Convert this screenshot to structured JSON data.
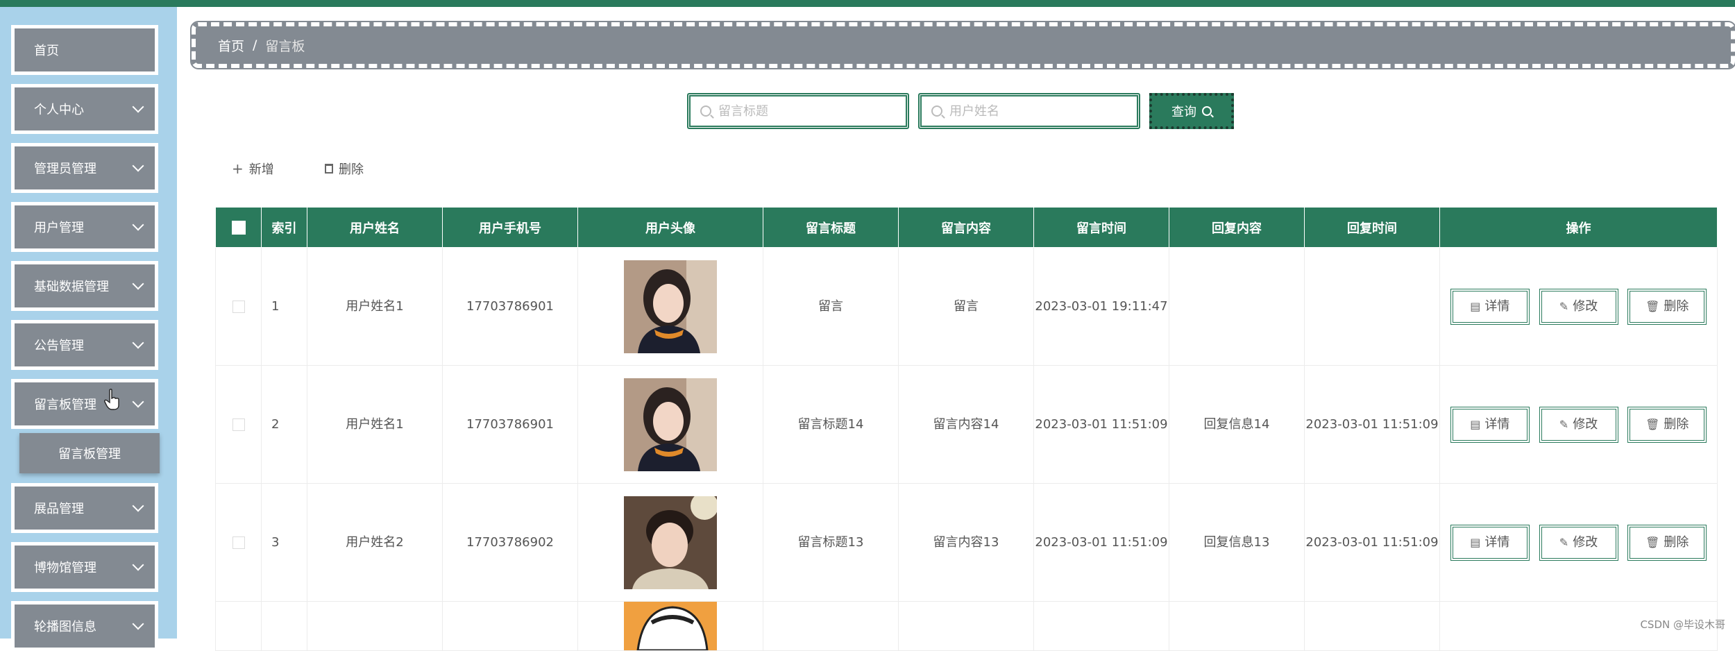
{
  "sidebar": {
    "items": [
      {
        "label": "首页",
        "has_children": false
      },
      {
        "label": "个人中心",
        "has_children": true
      },
      {
        "label": "管理员管理",
        "has_children": true
      },
      {
        "label": "用户管理",
        "has_children": true
      },
      {
        "label": "基础数据管理",
        "has_children": true
      },
      {
        "label": "公告管理",
        "has_children": true
      },
      {
        "label": "留言板管理",
        "has_children": true
      },
      {
        "label": "展品管理",
        "has_children": true
      },
      {
        "label": "博物馆管理",
        "has_children": true
      },
      {
        "label": "轮播图信息",
        "has_children": true
      }
    ],
    "submenu": {
      "label": "留言板管理"
    }
  },
  "breadcrumb": {
    "home": "首页",
    "separator": "/",
    "current": "留言板"
  },
  "search": {
    "title_placeholder": "留言标题",
    "name_placeholder": "用户姓名",
    "query_label": "查询"
  },
  "actions": {
    "add_label": "新增",
    "delete_label": "删除"
  },
  "table": {
    "headers": [
      "索引",
      "用户姓名",
      "用户手机号",
      "用户头像",
      "留言标题",
      "留言内容",
      "留言时间",
      "回复内容",
      "回复时间",
      "操作"
    ],
    "rows": [
      {
        "index": "1",
        "name": "用户姓名1",
        "phone": "17703786901",
        "avatar": "female-avatar",
        "title": "留言",
        "content": "留言",
        "time": "2023-03-01 19:11:47",
        "reply": "",
        "reply_time": ""
      },
      {
        "index": "2",
        "name": "用户姓名1",
        "phone": "17703786901",
        "avatar": "female-avatar",
        "title": "留言标题14",
        "content": "留言内容14",
        "time": "2023-03-01 11:51:09",
        "reply": "回复信息14",
        "reply_time": "2023-03-01 11:51:09"
      },
      {
        "index": "3",
        "name": "用户姓名2",
        "phone": "17703786902",
        "avatar": "male-avatar",
        "title": "留言标题13",
        "content": "留言内容13",
        "time": "2023-03-01 11:51:09",
        "reply": "回复信息13",
        "reply_time": "2023-03-01 11:51:09"
      }
    ],
    "row_buttons": {
      "detail": "详情",
      "edit": "修改",
      "delete": "删除"
    }
  },
  "watermark": "CSDN @毕设木哥",
  "colors": {
    "accent": "#2a7a5c",
    "sidebar_bg": "#a9d2ea",
    "menu_bg": "#838a92"
  }
}
